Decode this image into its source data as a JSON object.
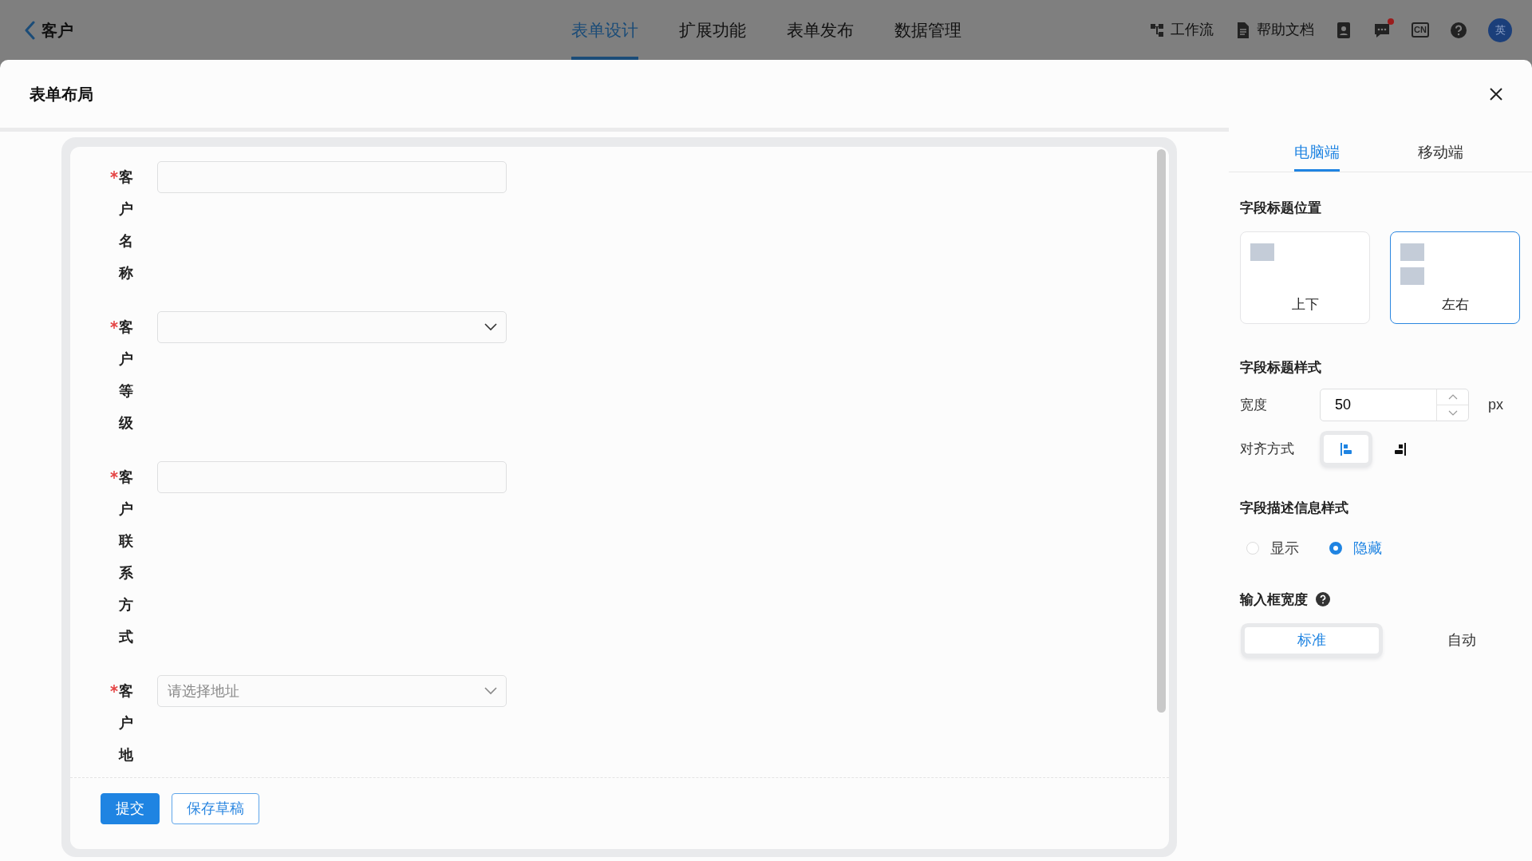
{
  "top_bar": {
    "back_label": "客户",
    "nav_tabs": [
      {
        "label": "表单设计",
        "selected": true
      },
      {
        "label": "扩展功能",
        "selected": false
      },
      {
        "label": "表单发布",
        "selected": false
      },
      {
        "label": "数据管理",
        "selected": false
      }
    ],
    "tools": [
      {
        "kind": "workflow",
        "label": "工作流"
      },
      {
        "kind": "docs",
        "label": "帮助文档"
      },
      {
        "kind": "contacts"
      },
      {
        "kind": "messages",
        "unread": true
      },
      {
        "kind": "language",
        "label": "CN"
      },
      {
        "kind": "help"
      },
      {
        "kind": "avatar",
        "label": "英"
      }
    ]
  },
  "modal": {
    "title": "表单布局"
  },
  "form": {
    "fields": [
      {
        "label": "客户名称",
        "required": true,
        "kind": "text"
      },
      {
        "label": "客户等级",
        "required": true,
        "kind": "select"
      },
      {
        "label": "客户联系方式",
        "required": true,
        "kind": "text"
      },
      {
        "label": "客户地",
        "required": true,
        "kind": "select",
        "placeholder": "请选择地址"
      }
    ],
    "buttons": [
      {
        "label": "提交",
        "kind": "primary"
      },
      {
        "label": "保存草稿",
        "kind": "outline"
      }
    ]
  },
  "settings": {
    "tabs": [
      {
        "label": "电脑端",
        "selected": true
      },
      {
        "label": "移动端",
        "selected": false
      }
    ],
    "title_position": {
      "heading": "字段标题位置",
      "options": [
        {
          "label": "上下",
          "kind": "stacked",
          "selected": false
        },
        {
          "label": "左右",
          "kind": "side",
          "selected": true
        }
      ]
    },
    "title_style": {
      "heading": "字段标题样式",
      "width_label": "宽度",
      "width_value": "50",
      "width_unit": "px",
      "align_label": "对齐方式",
      "align_options": [
        {
          "kind": "left",
          "selected": true
        },
        {
          "kind": "right",
          "selected": false
        }
      ]
    },
    "description_style": {
      "heading": "字段描述信息样式",
      "options": [
        {
          "label": "显示",
          "selected": false
        },
        {
          "label": "隐藏",
          "selected": true
        }
      ]
    },
    "input_width": {
      "heading": "输入框宽度",
      "options": [
        {
          "label": "标准",
          "selected": true
        },
        {
          "label": "自动",
          "selected": false
        }
      ]
    }
  }
}
